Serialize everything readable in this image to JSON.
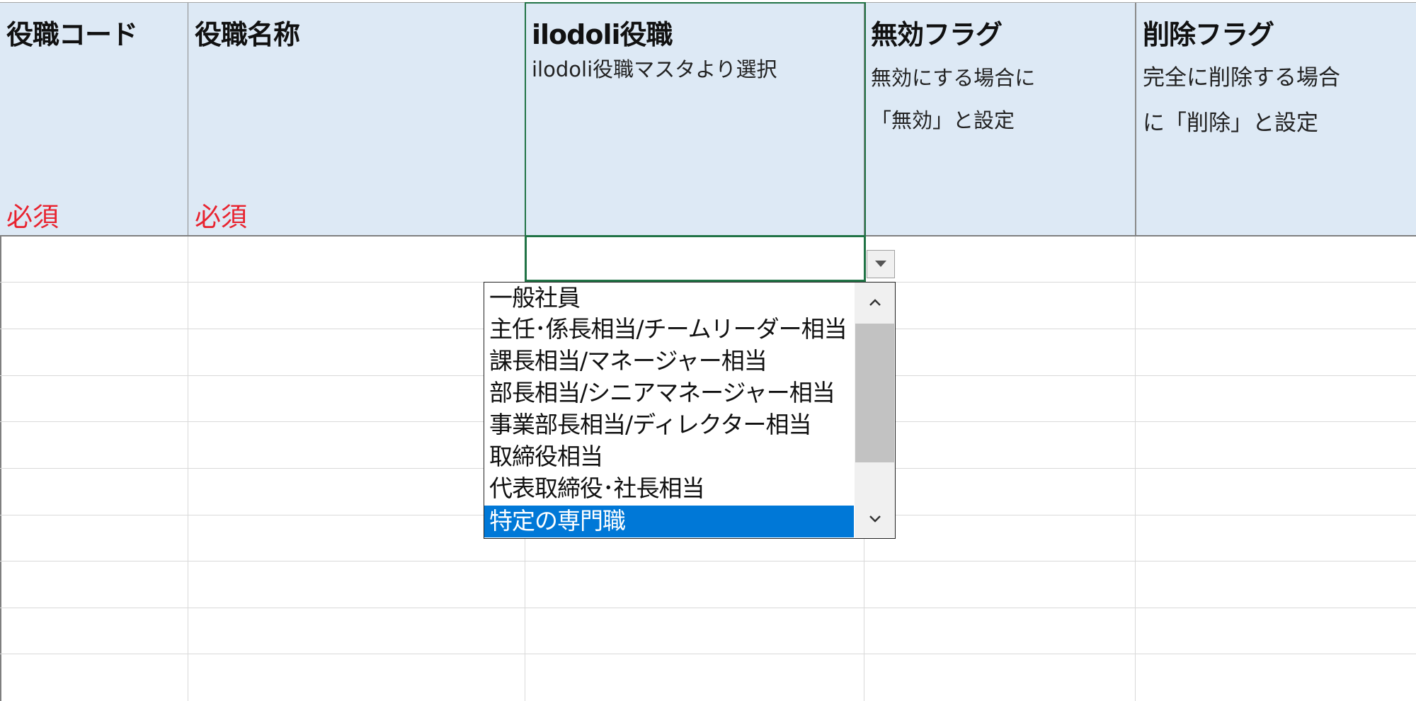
{
  "columns": [
    {
      "title": "役職コード",
      "required": "必須"
    },
    {
      "title": "役職名称",
      "required": "必須"
    },
    {
      "title": "ilodoli役職",
      "desc": "ilodoli役職マスタより選択"
    },
    {
      "title": "無効フラグ",
      "desc_line1": "無効にする場合に",
      "desc_line2": "「無効」と設定"
    },
    {
      "title": "削除フラグ",
      "desc_line1": "完全に削除する場合",
      "desc_line2": "に「削除」と設定"
    }
  ],
  "dropdown": {
    "options": [
      "一般社員",
      "主任･係長相当/チームリーダー相当",
      "課長相当/マネージャー相当",
      "部長相当/シニアマネージャー相当",
      "事業部長相当/ディレクター相当",
      "取締役相当",
      "代表取締役･社長相当",
      "特定の専門職"
    ],
    "selected_index": 7
  },
  "colors": {
    "header_bg": "#dde9f5",
    "required_text": "#e8232f",
    "active_border": "#217346",
    "selection": "#0078d7"
  }
}
